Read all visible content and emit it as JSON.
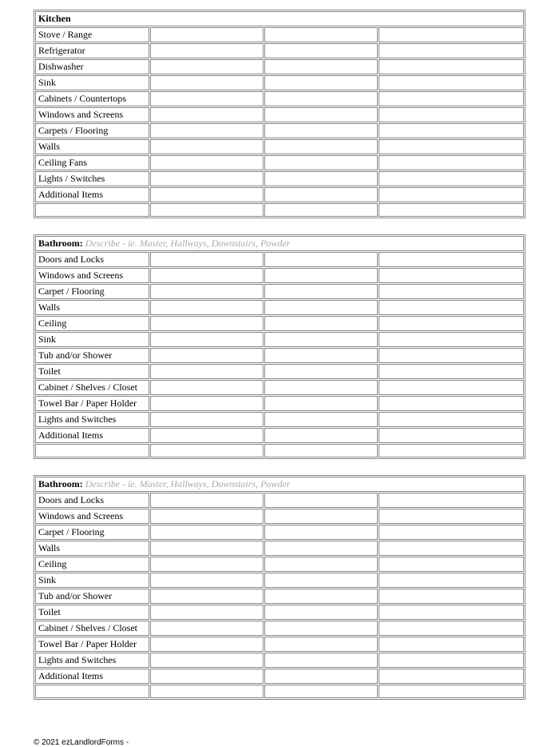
{
  "sections": [
    {
      "title": "Kitchen",
      "hint": "",
      "rows": [
        "Stove / Range",
        "Refrigerator",
        "Dishwasher",
        "Sink",
        "Cabinets / Countertops",
        "Windows and Screens",
        "Carpets / Flooring",
        "Walls",
        "Ceiling Fans",
        "Lights / Switches",
        "Additional Items",
        ""
      ]
    },
    {
      "title": "Bathroom: ",
      "hint": "Describe - ie. Master, Hallways, Downstairs, Powder",
      "rows": [
        "Doors and Locks",
        "Windows and Screens",
        "Carpet / Flooring",
        "Walls",
        "Ceiling",
        "Sink",
        "Tub and/or Shower",
        "Toilet",
        "Cabinet / Shelves / Closet",
        "Towel Bar / Paper Holder",
        "Lights and Switches",
        "Additional Items",
        ""
      ]
    },
    {
      "title": "Bathroom: ",
      "hint": "Describe - ie. Master, Hallways, Downstairs, Powder",
      "rows": [
        "Doors and Locks",
        "Windows and Screens",
        "Carpet / Flooring",
        "Walls",
        "Ceiling",
        "Sink",
        "Tub and/or Shower",
        "Toilet",
        "Cabinet / Shelves / Closet",
        "Towel Bar / Paper Holder",
        "Lights and Switches",
        "Additional Items",
        ""
      ]
    }
  ],
  "footer": "© 2021 ezLandlordForms -"
}
